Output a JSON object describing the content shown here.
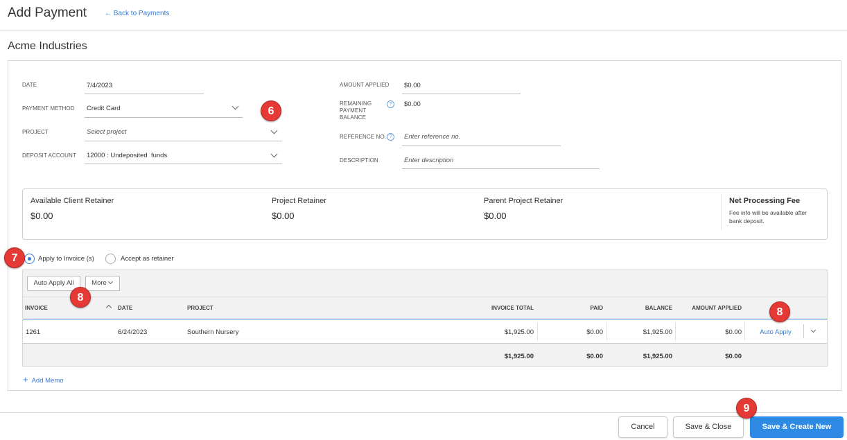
{
  "header": {
    "title": "Add Payment",
    "back_link": "← Back to Payments"
  },
  "client_name": "Acme Industries",
  "form": {
    "date": {
      "label": "DATE",
      "value": "7/4/2023"
    },
    "payment_method": {
      "label": "PAYMENT METHOD",
      "value": "Credit Card"
    },
    "project": {
      "label": "PROJECT",
      "placeholder": "Select project"
    },
    "deposit_account": {
      "label": "DEPOSIT ACCOUNT",
      "value": "12000 : Undeposited  funds"
    },
    "amount_applied": {
      "label": "AMOUNT APPLIED",
      "value": "$0.00"
    },
    "remaining_balance": {
      "label_lines": [
        "REMAINING",
        "PAYMENT",
        "BALANCE"
      ],
      "value": "$0.00"
    },
    "reference_no": {
      "label": "REFERENCE NO.",
      "placeholder": "Enter reference no."
    },
    "description": {
      "label": "DESCRIPTION",
      "placeholder": "Enter description"
    }
  },
  "retainers": {
    "client": {
      "title": "Available Client Retainer",
      "value": "$0.00"
    },
    "project": {
      "title": "Project Retainer",
      "value": "$0.00"
    },
    "parent": {
      "title": "Parent Project Retainer",
      "value": "$0.00"
    },
    "fee": {
      "title": "Net Processing Fee",
      "note_lines": [
        "Fee info will be available after",
        "bank deposit."
      ]
    }
  },
  "apply_options": {
    "invoice": "Apply to Invoice (s)",
    "retainer": "Accept as retainer",
    "selected": "invoice"
  },
  "toolbar": {
    "auto_apply_all": "Auto Apply All",
    "more": "More"
  },
  "table": {
    "headers": {
      "invoice": "INVOICE",
      "date": "DATE",
      "project": "PROJECT",
      "invoice_total": "INVOICE TOTAL",
      "paid": "PAID",
      "balance": "BALANCE",
      "amount_applied": "AMOUNT APPLIED"
    },
    "row": {
      "invoice": "1261",
      "date": "6/24/2023",
      "project": "Southern Nursery",
      "invoice_total": "$1,925.00",
      "paid": "$0.00",
      "balance": "$1,925.00",
      "amount_applied": "$0.00",
      "action": "Auto Apply"
    },
    "totals": {
      "invoice_total": "$1,925.00",
      "paid": "$0.00",
      "balance": "$1,925.00",
      "amount_applied": "$0.00"
    }
  },
  "add_memo": "Add Memo",
  "footer": {
    "cancel": "Cancel",
    "save_close": "Save & Close",
    "save_new": "Save & Create New"
  },
  "callouts": {
    "c6": "6",
    "c7": "7",
    "c8a": "8",
    "c8b": "8",
    "c9": "9"
  },
  "colors": {
    "accent": "#2f8ae5",
    "link": "#3a7bd5",
    "badge": "#e53935"
  }
}
